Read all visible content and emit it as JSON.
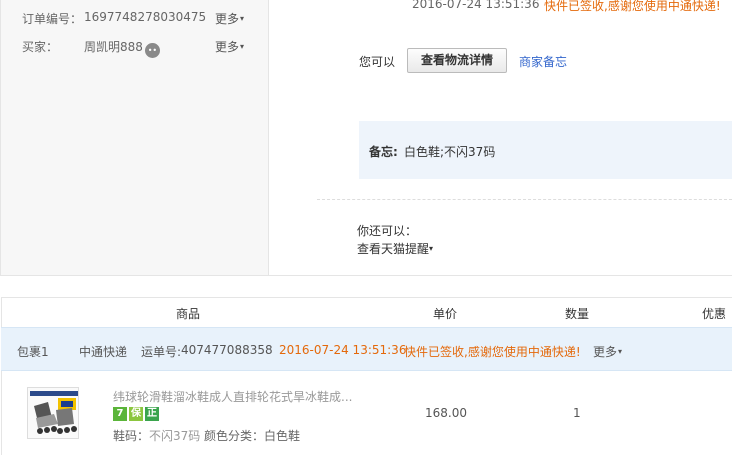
{
  "order_info": {
    "order_no_label": "订单编号：",
    "order_no_value": "1697748278030475",
    "buyer_label": "买家：",
    "buyer_value": "周凯明888",
    "more_label": "更多"
  },
  "top_status": {
    "time": "2016-07-24 13:51:36",
    "message": "快件已签收,感谢您使用中通快递!"
  },
  "actions": {
    "prefix": "您可以",
    "logistics_button": "查看物流详情",
    "seller_memo_link": "商家备忘"
  },
  "memo": {
    "label": "备忘:",
    "value": "白色鞋;不闪37码"
  },
  "extra": {
    "prefix": "你还可以：",
    "tmall_remind": "查看天猫提醒"
  },
  "table": {
    "headers": {
      "product": "商品",
      "price": "单价",
      "quantity": "数量",
      "discount": "优惠"
    }
  },
  "package": {
    "name": "包裹1",
    "carrier": "中通快递",
    "tracking_label": "运单号:",
    "tracking_no": "407477088358",
    "time": "2016-07-24 13:51:36",
    "message": "快件已签收,感谢您使用中通快递!",
    "more_label": "更多"
  },
  "item": {
    "title": "纬球轮滑鞋溜冰鞋成人直排轮花式旱冰鞋成...",
    "tags": [
      "7",
      "保",
      "正"
    ],
    "size_label": "鞋码：",
    "size_value": "不闪37码",
    "color_label": "颜色分类：",
    "color_value": "白色鞋",
    "price": "168.00",
    "quantity": "1"
  },
  "colors": {
    "accent_orange": "#e4690b",
    "link_blue": "#3366cc",
    "package_bar": "#e8f2fb"
  }
}
